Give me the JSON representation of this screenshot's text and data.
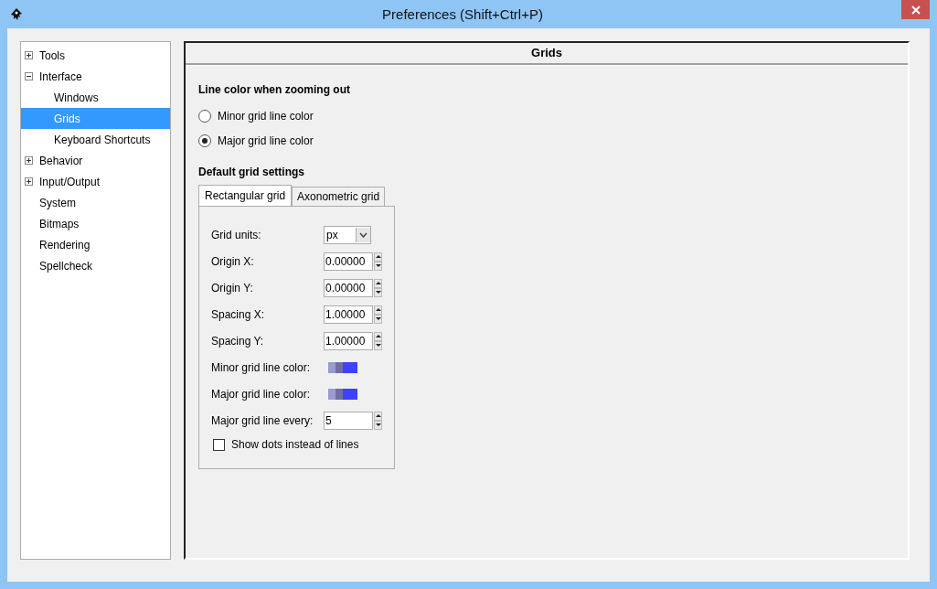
{
  "window": {
    "title": "Preferences (Shift+Ctrl+P)"
  },
  "sidebar": {
    "items": [
      {
        "label": "Tools",
        "expanded": false,
        "selected": false
      },
      {
        "label": "Interface",
        "expanded": true,
        "selected": false,
        "children": [
          {
            "label": "Windows",
            "selected": false
          },
          {
            "label": "Grids",
            "selected": true
          },
          {
            "label": "Keyboard Shortcuts",
            "selected": false
          }
        ]
      },
      {
        "label": "Behavior",
        "expanded": false,
        "selected": false
      },
      {
        "label": "Input/Output",
        "expanded": false,
        "selected": false
      },
      {
        "label": "System",
        "selected": false
      },
      {
        "label": "Bitmaps",
        "selected": false
      },
      {
        "label": "Rendering",
        "selected": false
      },
      {
        "label": "Spellcheck",
        "selected": false
      }
    ]
  },
  "panel": {
    "title": "Grids",
    "zoom_section": {
      "heading": "Line color when zooming out",
      "options": [
        {
          "label": "Minor grid line color",
          "selected": false
        },
        {
          "label": "Major grid line color",
          "selected": true
        }
      ]
    },
    "grid_section": {
      "heading": "Default grid settings",
      "tabs": [
        {
          "label": "Rectangular grid",
          "selected": true
        },
        {
          "label": "Axonometric grid",
          "selected": false
        }
      ],
      "fields": [
        {
          "kind": "dropdown",
          "label": "Grid units:",
          "value": "px"
        },
        {
          "kind": "spin",
          "label": "Origin X:",
          "value": "0.00000"
        },
        {
          "kind": "spin",
          "label": "Origin Y:",
          "value": "0.00000"
        },
        {
          "kind": "spin",
          "label": "Spacing X:",
          "value": "1.00000"
        },
        {
          "kind": "spin",
          "label": "Spacing Y:",
          "value": "1.00000"
        },
        {
          "kind": "color",
          "label": "Minor grid line color:"
        },
        {
          "kind": "color",
          "label": "Major grid line color:"
        },
        {
          "kind": "spin",
          "label": "Major grid line every:",
          "value": "5"
        }
      ],
      "checkbox": {
        "label": "Show dots instead of lines",
        "checked": false
      }
    }
  }
}
